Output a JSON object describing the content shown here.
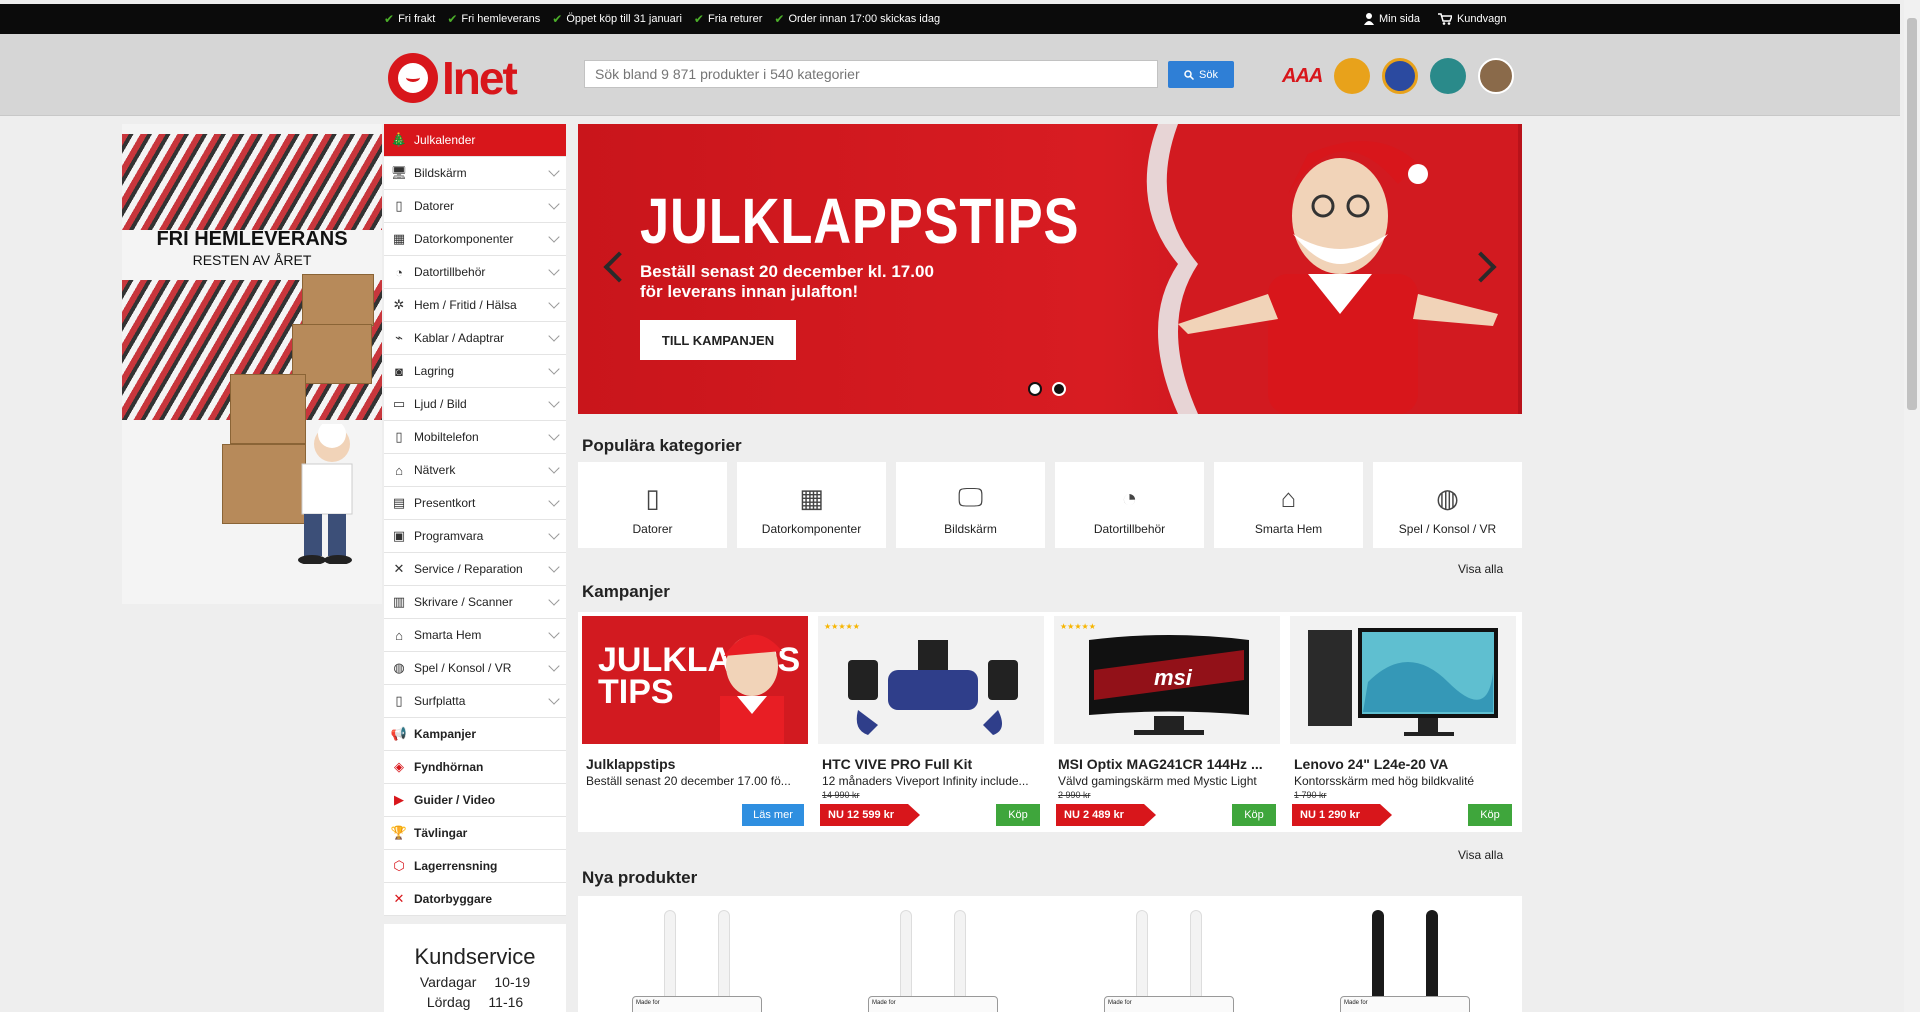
{
  "topbar": {
    "usps": [
      "Fri frakt",
      "Fri hemleverans",
      "Öppet köp till 31 januari",
      "Fria returer",
      "Order innan 17:00 skickas idag"
    ],
    "min_sida": "Min sida",
    "kundvagn": "Kundvagn"
  },
  "header": {
    "logo_text": "Inet",
    "search_placeholder": "Sök bland 9 871 produkter i 540 kategorier",
    "search_button": "Sök",
    "badge_aaa": "AAA"
  },
  "promo": {
    "title": "FRI HEMLEVERANS",
    "subtitle": "RESTEN AV ÅRET"
  },
  "menu": {
    "items": [
      {
        "label": "Julkalender",
        "icon": "tree-icon",
        "glyph": "🎄"
      },
      {
        "label": "Bildskärm",
        "icon": "monitor-icon",
        "glyph": "🖥"
      },
      {
        "label": "Datorer",
        "icon": "computer-icon",
        "glyph": "▯"
      },
      {
        "label": "Datorkomponenter",
        "icon": "component-icon",
        "glyph": "▦"
      },
      {
        "label": "Datortillbehör",
        "icon": "mouse-icon",
        "glyph": "◔"
      },
      {
        "label": "Hem / Fritid / Hälsa",
        "icon": "home-icon",
        "glyph": "✲"
      },
      {
        "label": "Kablar / Adaptrar",
        "icon": "cable-icon",
        "glyph": "⌁"
      },
      {
        "label": "Lagring",
        "icon": "storage-icon",
        "glyph": "◙"
      },
      {
        "label": "Ljud / Bild",
        "icon": "sound-icon",
        "glyph": "▭"
      },
      {
        "label": "Mobiltelefon",
        "icon": "phone-icon",
        "glyph": "▯"
      },
      {
        "label": "Nätverk",
        "icon": "network-icon",
        "glyph": "⌂"
      },
      {
        "label": "Presentkort",
        "icon": "gift-icon",
        "glyph": "▤"
      },
      {
        "label": "Programvara",
        "icon": "software-icon",
        "glyph": "▣"
      },
      {
        "label": "Service / Reparation",
        "icon": "tools-icon",
        "glyph": "✕"
      },
      {
        "label": "Skrivare / Scanner",
        "icon": "printer-icon",
        "glyph": "▥"
      },
      {
        "label": "Smarta Hem",
        "icon": "smart-home-icon",
        "glyph": "⌂"
      },
      {
        "label": "Spel / Konsol / VR",
        "icon": "gamepad-icon",
        "glyph": "◍"
      },
      {
        "label": "Surfplatta",
        "icon": "tablet-icon",
        "glyph": "▯"
      }
    ],
    "special": [
      {
        "label": "Kampanjer",
        "icon": "megaphone-icon",
        "glyph": "📢"
      },
      {
        "label": "Fyndhörnan",
        "icon": "tag-icon",
        "glyph": "◈"
      },
      {
        "label": "Guider / Video",
        "icon": "youtube-icon",
        "glyph": "▶"
      },
      {
        "label": "Tävlingar",
        "icon": "trophy-icon",
        "glyph": "🏆"
      },
      {
        "label": "Lagerrensning",
        "icon": "box-icon",
        "glyph": "⬡"
      },
      {
        "label": "Datorbyggare",
        "icon": "tools-icon",
        "glyph": "✕"
      }
    ]
  },
  "kundservice": {
    "title": "Kundservice",
    "rows": [
      {
        "day": "Vardagar",
        "hours": "10-19"
      },
      {
        "day": "Lördag",
        "hours": "11-16"
      }
    ]
  },
  "hero": {
    "title": "JULKLAPPSTIPS",
    "line1": "Beställ senast 20 december kl. 17.00",
    "line2": "för leverans innan julafton!",
    "cta": "TILL KAMPANJEN"
  },
  "popular": {
    "title": "Populära kategorier",
    "visa_alla": "Visa alla",
    "items": [
      {
        "label": "Datorer",
        "icon": "computer-icon",
        "glyph": "▯"
      },
      {
        "label": "Datorkomponenter",
        "icon": "component-icon",
        "glyph": "▦"
      },
      {
        "label": "Bildskärm",
        "icon": "monitor-icon",
        "glyph": "🖵"
      },
      {
        "label": "Datortillbehör",
        "icon": "mouse-icon",
        "glyph": "◔"
      },
      {
        "label": "Smarta Hem",
        "icon": "smart-home-icon",
        "glyph": "⌂"
      },
      {
        "label": "Spel / Konsol / VR",
        "icon": "gamepad-icon",
        "glyph": "◍"
      }
    ]
  },
  "kampanjer": {
    "title": "Kampanjer",
    "visa_alla": "Visa alla",
    "cards": [
      {
        "title": "Julklappstips",
        "desc": "Beställ senast 20 december 17.00 fö...",
        "button": "Läs mer"
      },
      {
        "title": "HTC VIVE PRO Full Kit",
        "desc": "12 månaders Viveport Infinity include...",
        "old_price": "14 990 kr",
        "price": "NU 12 599 kr",
        "button": "Köp"
      },
      {
        "title": "MSI Optix MAG241CR 144Hz ...",
        "desc": "Välvd gamingskärm med Mystic Light",
        "old_price": "2 990 kr",
        "price": "NU 2 489 kr",
        "button": "Köp"
      },
      {
        "title": "Lenovo 24\" L24e-20 VA",
        "desc": "Kontorsskärm med hög bildkvalité",
        "old_price": "1 790 kr",
        "price": "NU 1 290 kr",
        "button": "Köp"
      }
    ],
    "card1_img_text": "JULKLAPPS TIPS",
    "card3_brand": "msi"
  },
  "nya": {
    "title": "Nya produkter",
    "box_text": "Made for"
  }
}
